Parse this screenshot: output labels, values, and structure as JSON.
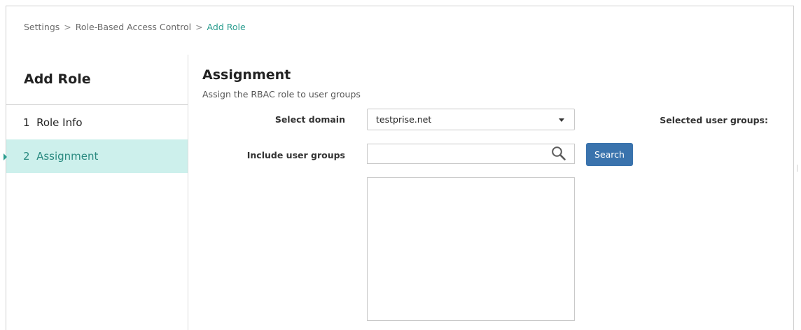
{
  "breadcrumb": {
    "items": [
      "Settings",
      "Role-Based Access Control",
      "Add Role"
    ],
    "separator": ">"
  },
  "sidebar": {
    "title": "Add Role",
    "steps": [
      {
        "number": "1",
        "label": "Role Info"
      },
      {
        "number": "2",
        "label": "Assignment",
        "active": true
      }
    ]
  },
  "main": {
    "heading": "Assignment",
    "subheading": "Assign the RBAC role to user groups",
    "select_domain_label": "Select domain",
    "domain_value": "testprise.net",
    "include_groups_label": "Include user groups",
    "include_groups_value": "",
    "search_button_label": "Search",
    "selected_groups_label": "Selected user groups:"
  },
  "colors": {
    "accent": "#2a9d8f",
    "active_step_bg": "#cdf0ec",
    "button": "#3a73ad"
  }
}
